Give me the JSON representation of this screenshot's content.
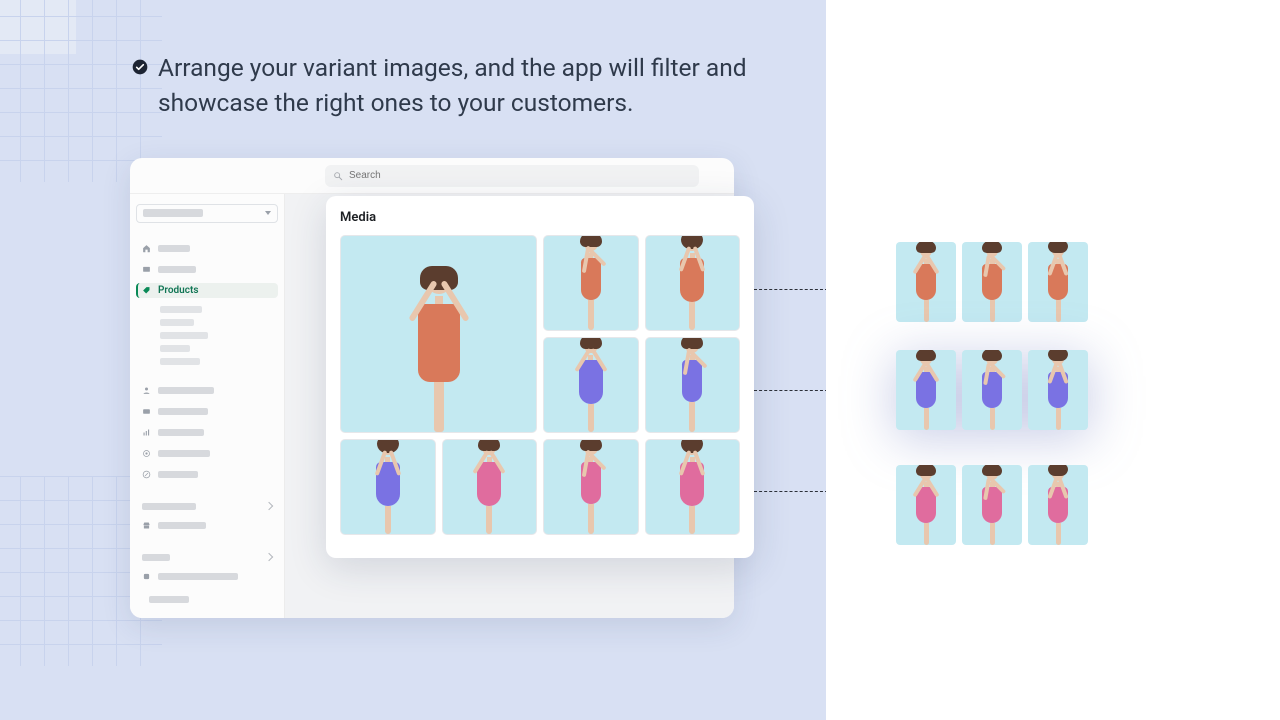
{
  "headline": "Arrange your variant images, and the app will filter and showcase the right ones to your customers.",
  "admin": {
    "search_placeholder": "Search",
    "active_nav_label": "Products"
  },
  "media": {
    "title": "Media",
    "tiles": [
      {
        "color": "orange",
        "pose": "front",
        "large": true
      },
      {
        "color": "orange",
        "pose": "side"
      },
      {
        "color": "orange",
        "pose": "back"
      },
      {
        "color": "purple",
        "pose": "front"
      },
      {
        "color": "purple",
        "pose": "side"
      },
      {
        "color": "purple",
        "pose": "back"
      },
      {
        "color": "pink",
        "pose": "front"
      },
      {
        "color": "pink",
        "pose": "side"
      },
      {
        "color": "pink",
        "pose": "back"
      }
    ]
  },
  "variants": [
    {
      "color": "orange",
      "poses": [
        "front",
        "side",
        "back"
      ]
    },
    {
      "color": "purple",
      "poses": [
        "front",
        "side",
        "back"
      ],
      "highlight": true
    },
    {
      "color": "pink",
      "poses": [
        "front",
        "side",
        "back"
      ]
    }
  ]
}
